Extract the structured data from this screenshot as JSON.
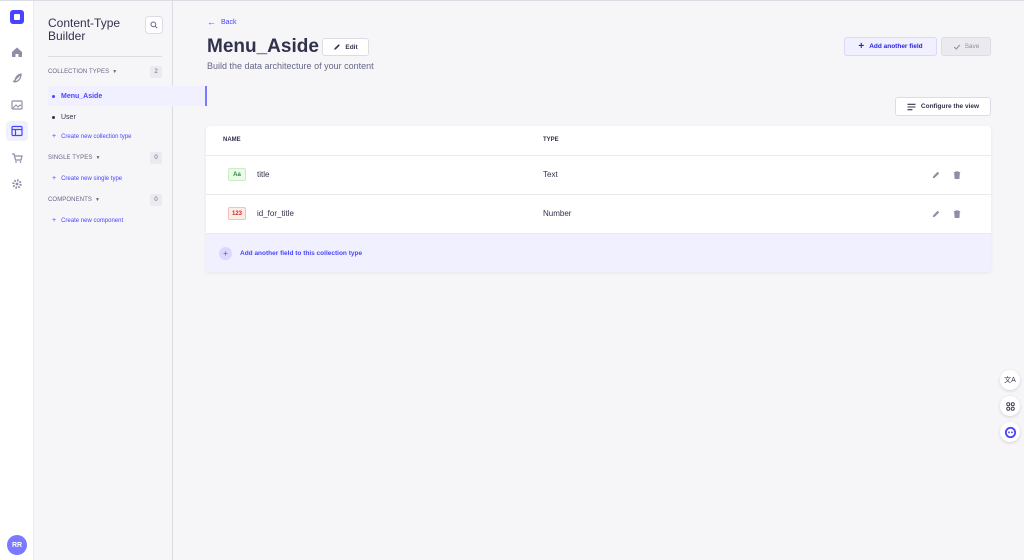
{
  "app": {
    "avatar_initials": "RR",
    "accent_color": "#4945ff"
  },
  "rail": {
    "items": [
      {
        "icon": "home-icon"
      },
      {
        "icon": "feather-icon"
      },
      {
        "icon": "image-icon"
      },
      {
        "icon": "layout-icon",
        "active": true
      },
      {
        "icon": "cart-icon"
      },
      {
        "icon": "gear-icon"
      }
    ]
  },
  "sidebar": {
    "title": "Content-Type Builder",
    "collection_types": {
      "label": "COLLECTION TYPES",
      "count": "2",
      "items": [
        "Menu_Aside",
        "User"
      ],
      "create_label": "Create new collection type"
    },
    "single_types": {
      "label": "SINGLE TYPES",
      "count": "0",
      "create_label": "Create new single type"
    },
    "components": {
      "label": "COMPONENTS",
      "count": "0",
      "create_label": "Create new component"
    }
  },
  "header": {
    "back_label": "Back",
    "title": "Menu_Aside",
    "edit_label": "Edit",
    "subtitle": "Build the data architecture of your content",
    "add_field_label": "Add another field",
    "save_label": "Save",
    "configure_label": "Configure the view"
  },
  "table": {
    "columns": [
      "NAME",
      "TYPE"
    ],
    "rows": [
      {
        "badge": "Aa",
        "name": "title",
        "type": "Text"
      },
      {
        "badge": "123",
        "name": "id_for_title",
        "type": "Number"
      }
    ],
    "add_row_label": "Add another field to this collection type"
  },
  "floating": {
    "translate_label": "文A"
  }
}
